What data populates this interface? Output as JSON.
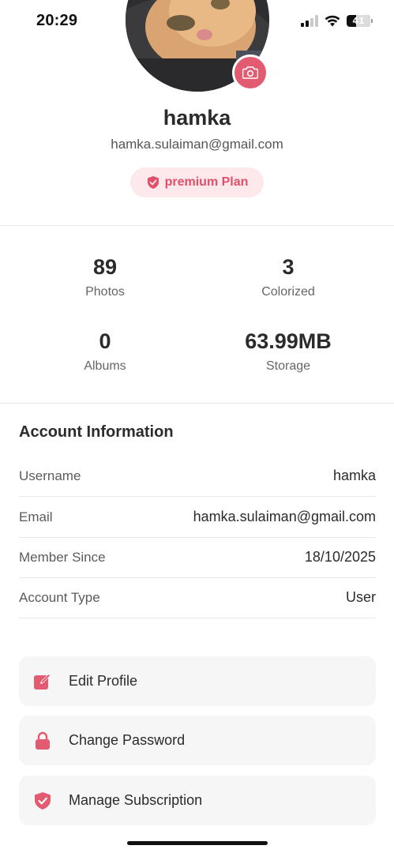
{
  "status": {
    "time": "20:29",
    "battery": "41",
    "battery_level": 0.41
  },
  "profile": {
    "name": "hamka",
    "email": "hamka.sulaiman@gmail.com",
    "plan": "premium Plan"
  },
  "stats": [
    {
      "value": "89",
      "label": "Photos"
    },
    {
      "value": "3",
      "label": "Colorized"
    },
    {
      "value": "0",
      "label": "Albums"
    },
    {
      "value": "63.99MB",
      "label": "Storage"
    }
  ],
  "account": {
    "title": "Account Information",
    "rows": [
      {
        "label": "Username",
        "value": "hamka"
      },
      {
        "label": "Email",
        "value": "hamka.sulaiman@gmail.com"
      },
      {
        "label": "Member Since",
        "value": "18/10/2025"
      },
      {
        "label": "Account Type",
        "value": "User"
      }
    ]
  },
  "actions": [
    {
      "label": "Edit Profile",
      "icon": "edit-icon"
    },
    {
      "label": "Change Password",
      "icon": "lock-icon"
    },
    {
      "label": "Manage Subscription",
      "icon": "shield-check-icon"
    }
  ],
  "colors": {
    "accent": "#e25b71",
    "badge_bg": "#fde8ec",
    "card_bg": "#f6f6f6"
  }
}
